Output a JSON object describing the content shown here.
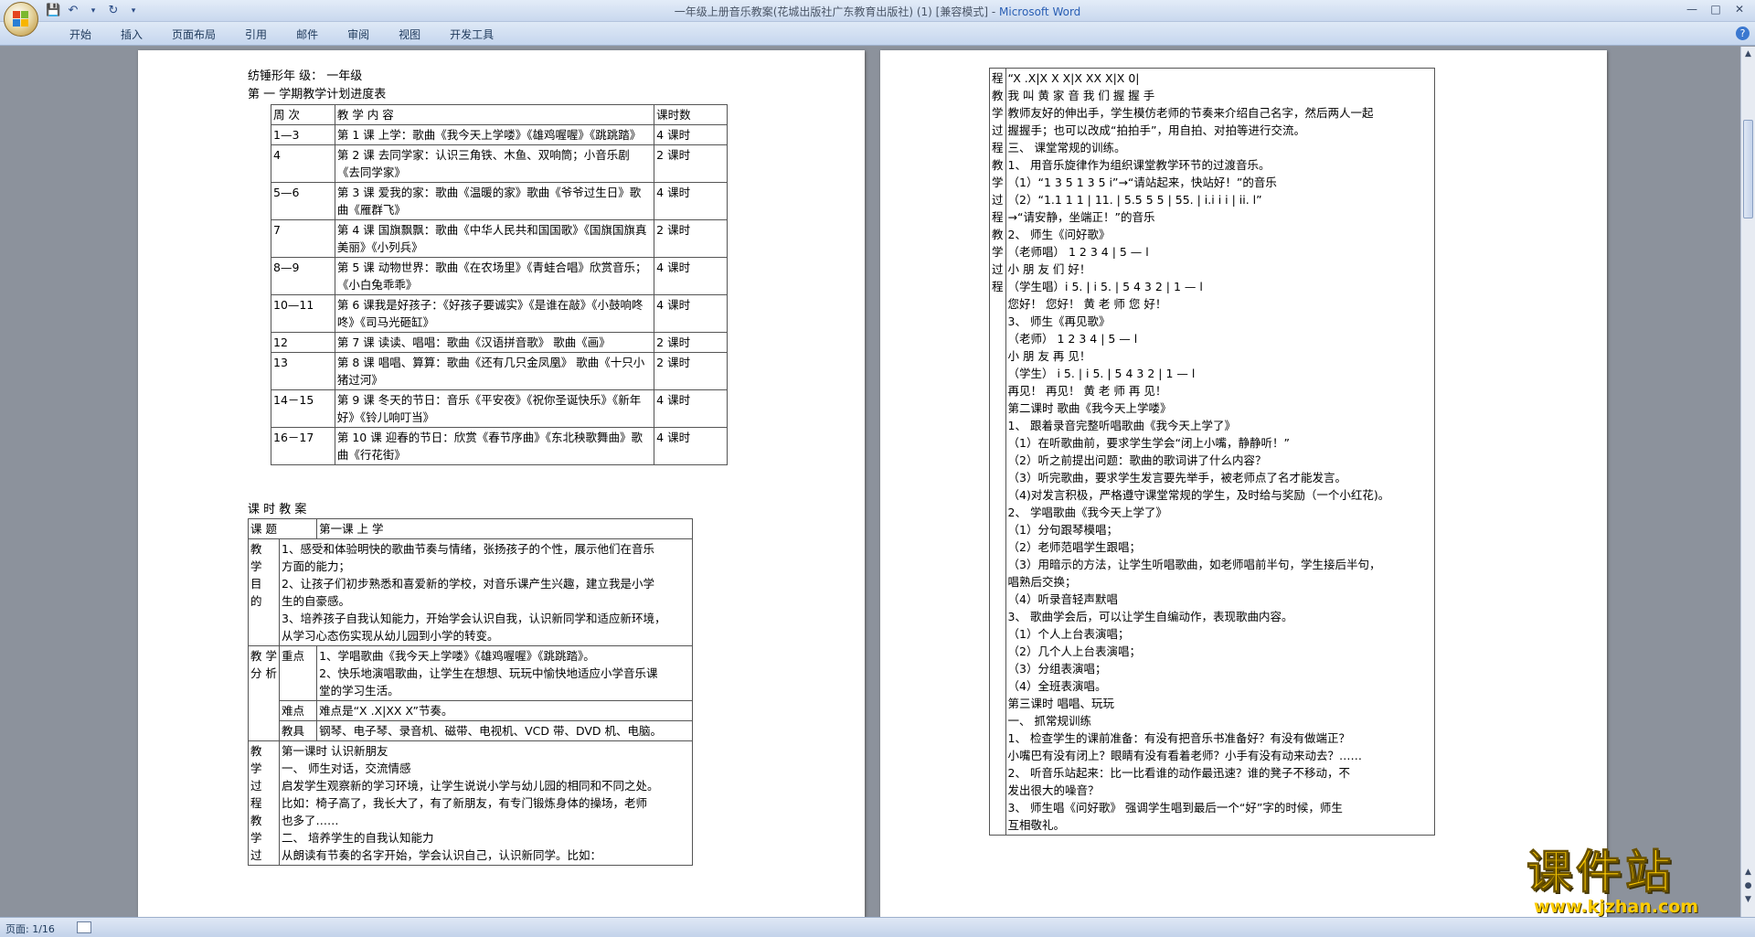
{
  "window": {
    "title": "一年级上册音乐教案(花城出版社广东教育出版社) (1) [兼容模式] - ",
    "app_name": "Microsoft Word"
  },
  "quick_access": {
    "save_icon": "save-icon",
    "undo_icon": "undo-icon",
    "redo_icon": "redo-icon"
  },
  "ribbon": {
    "tabs": [
      "开始",
      "插入",
      "页面布局",
      "引用",
      "邮件",
      "审阅",
      "视图",
      "开发工具"
    ]
  },
  "status": {
    "page": "页面: 1/16"
  },
  "watermark": {
    "main": "课件站",
    "url": "www.kjzhan.com"
  },
  "page1": {
    "header_line": "纺锤形年     级：   一年级",
    "schedule_title": "第 一 学期教学计划进度表",
    "schedule_headers": [
      "周  次",
      "教  学  内  容",
      "课时数"
    ],
    "schedule_rows": [
      [
        "1—3",
        "第 1 课  上学：歌曲《我今天上学喽》《雄鸡喔喔》《跳跳踏》",
        "4 课时"
      ],
      [
        "4",
        "第 2 课  去同学家：认识三角铁、木鱼、双响筒；小音乐剧《去同学家》",
        "2 课时"
      ],
      [
        "5—6",
        "第 3 课  爱我的家：歌曲《温暖的家》歌曲《爷爷过生日》歌曲《雁群飞》",
        "4 课时"
      ],
      [
        "7",
        "第 4 课  国旗飘飘：歌曲《中华人民共和国国歌》《国旗国旗真美丽》《小列兵》",
        "2 课时"
      ],
      [
        "8—9",
        "第 5 课  动物世界：歌曲《在农场里》《青蛙合唱》欣赏音乐；《小白兔乖乖》",
        "4 课时"
      ],
      [
        "10—11",
        "第 6 课我是好孩子：《好孩子要诚实》《是谁在敲》《小鼓响咚咚》《司马光砸缸》",
        "4 课时"
      ],
      [
        "12",
        "第 7 课  读读、唱唱：歌曲《汉语拼音歌》 歌曲《画》",
        "2 课时"
      ],
      [
        "13",
        "第 8 课  唱唱、算算：歌曲《还有几只金凤凰》 歌曲《十只小猪过河》",
        "2 课时"
      ],
      [
        "14－15",
        "第 9 课  冬天的节日：音乐《平安夜》《祝你圣诞快乐》《新年好》《铃儿响叮当》",
        "4 课时"
      ],
      [
        "16－17",
        "第 10 课  迎春的节日：欣赏《春节序曲》《东北秧歌舞曲》歌曲《行花街》",
        "4 课时"
      ]
    ],
    "lesson_title": "课  时  教  案",
    "lesson": {
      "topic_label": "课  题",
      "topic": "第一课   上  学",
      "goal_label": [
        "教",
        "学",
        "目",
        "的"
      ],
      "goal_lines": [
        "1、感受和体验明快的歌曲节奏与情绪，张扬孩子的个性，展示他们在音乐",
        "方面的能力；",
        "2、让孩子们初步熟悉和喜爱新的学校，对音乐课产生兴趣，建立我是小学",
        "生的自豪感。",
        "3、培养孩子自我认知能力，开始学会认识自我，认识新同学和适应新环境，",
        "从学习心态伤实现从幼儿园到小学的转变。"
      ],
      "analysis_label": [
        "教 学",
        "分 析"
      ],
      "key_label": "重点",
      "key_lines": [
        "1、学唱歌曲《我今天上学喽》《雄鸡喔喔》《跳跳踏》。",
        "2、快乐地演唱歌曲，让学生在想想、玩玩中愉快地适应小学音乐课",
        "堂的学习生活。"
      ],
      "difficulty_label": "难点",
      "difficulty": "难点是“X  .X|XX  X”节奏。",
      "tools_label": "教具",
      "tools": "钢琴、电子琴、录音机、磁带、电视机、VCD 带、DVD 机、电脑。",
      "process_label": [
        "教",
        "学",
        "过",
        "程",
        "教",
        "学",
        "过"
      ],
      "process_lines": [
        "第一课时    认识新朋友",
        "一、      师生对话，交流情感",
        "启发学生观察新的学习环境，让学生说说小学与幼儿园的相同和不同之处。",
        "比如：椅子高了，我长大了，有了新朋友，有专门锻炼身体的操场，老师",
        "也多了……",
        "二、      培养学生的自我认知能力",
        "从朗读有节奏的名字开始，学会认识自己，认识新同学。比如："
      ]
    }
  },
  "page2": {
    "side_label": [
      "程",
      "教",
      "学",
      "过",
      "程",
      "教",
      "学",
      "过",
      "程",
      "教",
      "学",
      "过",
      "程"
    ],
    "lines": [
      "“X  .X|X X  X|X  XX  X|X  0|",
      "我 叫  黄 家 音  我 们 握 握 手",
      "教师友好的伸出手，学生模仿老师的节奏来介绍自己名字，然后两人一起",
      "握握手；也可以改成“拍拍手”，用自拍、对拍等进行交流。",
      "三、      课堂常规的训练。",
      "1、          用音乐旋律作为组织课堂教学环节的过渡音乐。",
      "（1）“1 3 5 1 3 5 i”→“请站起来，快站好！”的音乐",
      "（2）“1.1 1 1 | 11. | 5.5 5 5 | 55. | i.i i i | ii. l”",
      "→“请安静，坐端正！”的音乐",
      "2、       师生《问好歌》",
      "（老师唱）  1   2   3   4 |    5 — l",
      "小 朋 友 们    好！",
      "（学生唱）i 5.   | i 5.   | 5   4   3   2 | 1 — l",
      "您好！  您好！   黄 老 师 您   好！",
      "3、       师生《再见歌》",
      "（老师）  1   2   3   4 | 5 — l",
      "小 朋 友 再   见！",
      "（学生）  i 5.   | i 5.   | 5   4   3   2 |   1 — l",
      "再见！   再见！    黄 老  师 再   见！",
      "第二课时   歌曲《我今天上学喽》",
      "1、        跟着录音完整听唱歌曲《我今天上学了》",
      "（1）在听歌曲前，要求学生学会“闭上小嘴，静静听！”",
      "（2）听之前提出问题：歌曲的歌词讲了什么内容？",
      "（3）听完歌曲，要求学生发言要先举手，被老师点了名才能发言。",
      "（4)对发言积极，严格遵守课堂常规的学生，及时给与奖励（一个小红花)。",
      "2、        学唱歌曲《我今天上学了》",
      "（1）分句跟琴模唱；",
      "（2）老师范唱学生跟唱；",
      "（3）用暗示的方法，让学生听唱歌曲，如老师唱前半句，学生接后半句，",
      "唱熟后交换；",
      "（4）听录音轻声默唱",
      "3、       歌曲学会后，可以让学生自编动作，表现歌曲内容。",
      "（1）个人上台表演唱；",
      "（2）几个人上台表演唱；",
      "（3）分组表演唱；",
      "（4）全班表演唱。",
      "第三课时    唱唱、玩玩",
      "一、      抓常规训练",
      "1、        检查学生的课前准备：有没有把音乐书准备好？有没有做端正？",
      "小嘴巴有没有闭上？眼睛有没有看着老师？小手有没有动来动去？……",
      "2、        听音乐站起来：比一比看谁的动作最迅速？谁的凳子不移动，不",
      "发出很大的噪音？",
      "3、        师生唱《问好歌》 强调学生唱到最后一个“好”字的时候，师生",
      "互相敬礼。"
    ]
  }
}
